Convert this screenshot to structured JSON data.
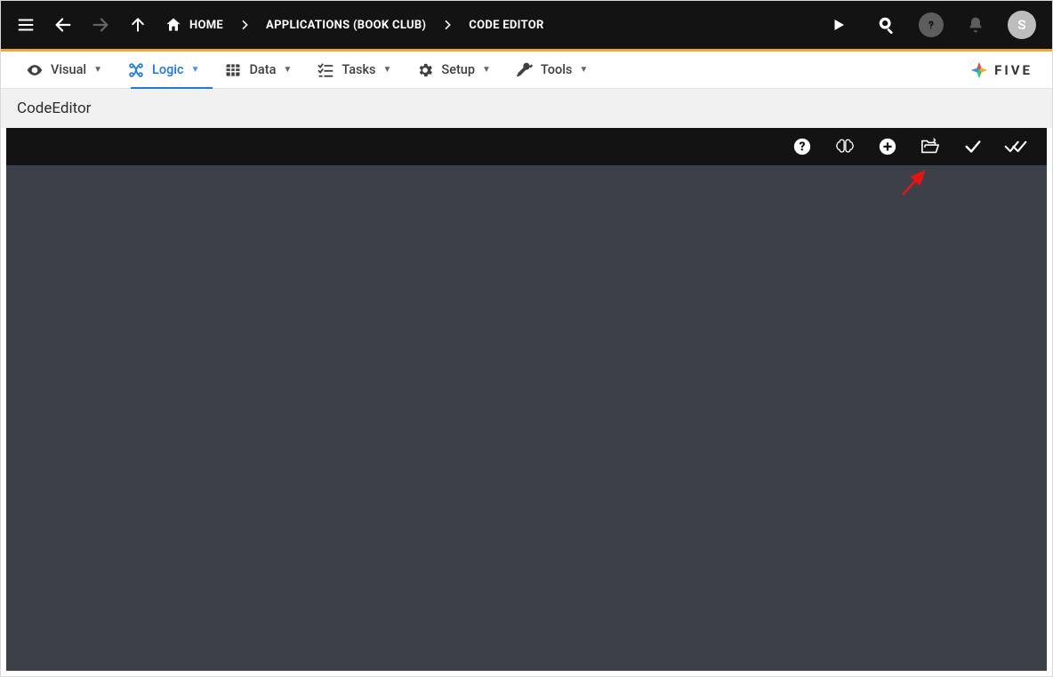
{
  "breadcrumbs": {
    "home": "HOME",
    "applications": "APPLICATIONS (BOOK CLUB)",
    "editor": "CODE EDITOR"
  },
  "avatar_initial": "S",
  "tabs": {
    "visual": "Visual",
    "logic": "Logic",
    "data": "Data",
    "tasks": "Tasks",
    "setup": "Setup",
    "tools": "Tools"
  },
  "logo_text": "FIVE",
  "subheader_title": "CodeEditor",
  "editor_toolbar": {
    "help": "help-icon",
    "ai": "brain-icon",
    "add": "add-icon",
    "open": "open-folder-icon",
    "save": "check-icon",
    "save_all": "double-check-icon"
  }
}
